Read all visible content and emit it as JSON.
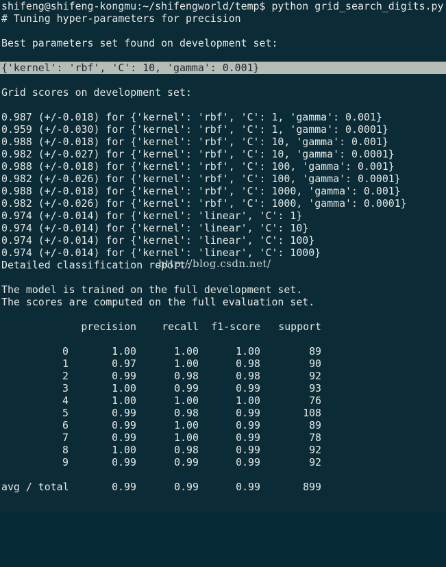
{
  "prompt": {
    "user_host_path": "shifeng@shifeng-kongmu:~/shifengworld/temp$",
    "command": "python grid_search_digits.py"
  },
  "lines": {
    "tuning": "# Tuning hyper-parameters for precision",
    "best_header": "Best parameters set found on development set:",
    "best_params": "{'kernel': 'rbf', 'C': 10, 'gamma': 0.001}",
    "grid_header": "Grid scores on development set:",
    "detailed_header": "Detailed classification report:",
    "model_trained": "The model is trained on the full development set.",
    "scores_computed": "The scores are computed on the full evaluation set."
  },
  "grid_scores": [
    "0.987 (+/-0.018) for {'kernel': 'rbf', 'C': 1, 'gamma': 0.001}",
    "0.959 (+/-0.030) for {'kernel': 'rbf', 'C': 1, 'gamma': 0.0001}",
    "0.988 (+/-0.018) for {'kernel': 'rbf', 'C': 10, 'gamma': 0.001}",
    "0.982 (+/-0.027) for {'kernel': 'rbf', 'C': 10, 'gamma': 0.0001}",
    "0.988 (+/-0.018) for {'kernel': 'rbf', 'C': 100, 'gamma': 0.001}",
    "0.982 (+/-0.026) for {'kernel': 'rbf', 'C': 100, 'gamma': 0.0001}",
    "0.988 (+/-0.018) for {'kernel': 'rbf', 'C': 1000, 'gamma': 0.001}",
    "0.982 (+/-0.026) for {'kernel': 'rbf', 'C': 1000, 'gamma': 0.0001}",
    "0.974 (+/-0.014) for {'kernel': 'linear', 'C': 1}",
    "0.974 (+/-0.014) for {'kernel': 'linear', 'C': 10}",
    "0.974 (+/-0.014) for {'kernel': 'linear', 'C': 100}",
    "0.974 (+/-0.014) for {'kernel': 'linear', 'C': 1000}"
  ],
  "watermark": "http://blog.csdn.net/",
  "report": {
    "headers": [
      "precision",
      "recall",
      "f1-score",
      "support"
    ],
    "rows": [
      [
        "0",
        "1.00",
        "1.00",
        "1.00",
        "89"
      ],
      [
        "1",
        "0.97",
        "1.00",
        "0.98",
        "90"
      ],
      [
        "2",
        "0.99",
        "0.98",
        "0.98",
        "92"
      ],
      [
        "3",
        "1.00",
        "0.99",
        "0.99",
        "93"
      ],
      [
        "4",
        "1.00",
        "1.00",
        "1.00",
        "76"
      ],
      [
        "5",
        "0.99",
        "0.98",
        "0.99",
        "108"
      ],
      [
        "6",
        "0.99",
        "1.00",
        "0.99",
        "89"
      ],
      [
        "7",
        "0.99",
        "1.00",
        "0.99",
        "78"
      ],
      [
        "8",
        "1.00",
        "0.98",
        "0.99",
        "92"
      ],
      [
        "9",
        "0.99",
        "0.99",
        "0.99",
        "92"
      ]
    ],
    "total": [
      "avg / total",
      "0.99",
      "0.99",
      "0.99",
      "899"
    ]
  },
  "colors": {
    "background": "#0b2c37",
    "foreground": "#e6e8e4",
    "selection": "#b8bcb6"
  }
}
